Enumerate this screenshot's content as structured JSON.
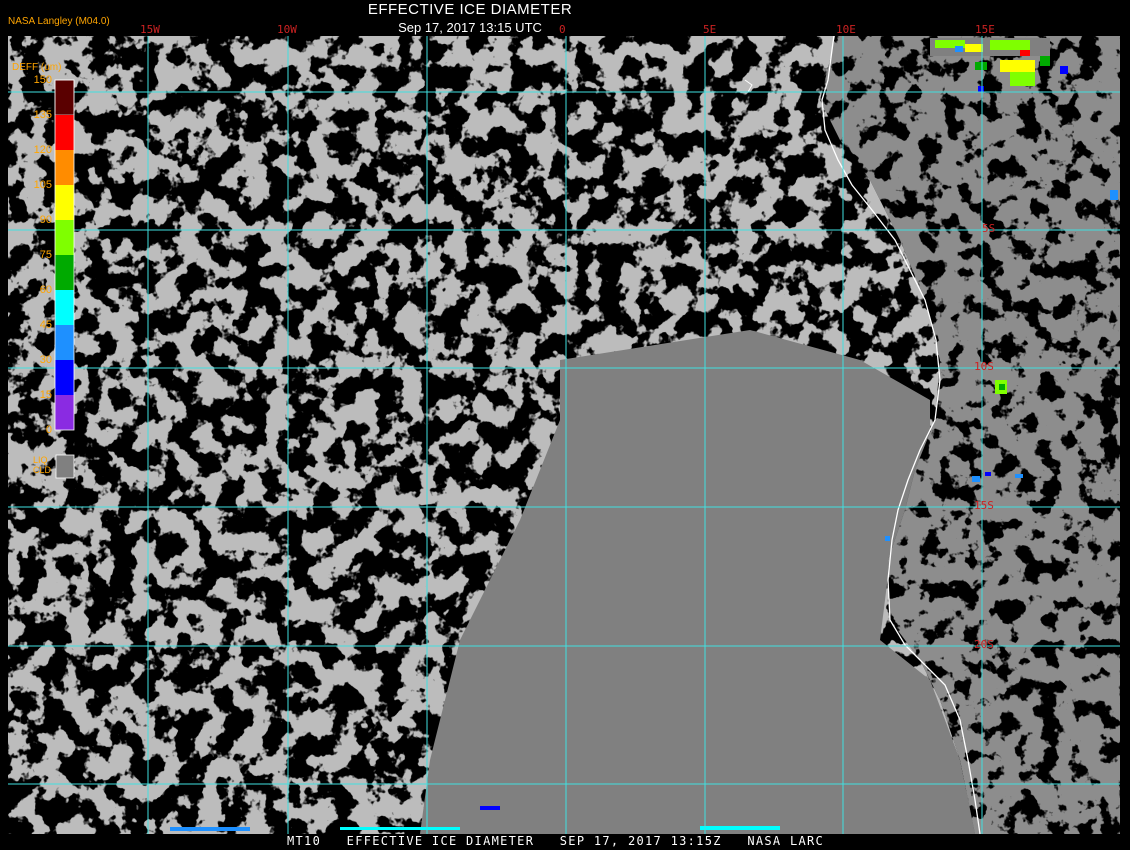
{
  "title": "EFFECTIVE ICE DIAMETER",
  "subtitle": "Sep 17, 2017 13:15 UTC",
  "producer": "NASA Langley (M04.0)",
  "footer": "MT10   EFFECTIVE ICE DIAMETER   SEP 17, 2017 13:15Z   NASA LARC",
  "legend": {
    "title": "DEFF (um)",
    "ticks": [
      "150",
      "135",
      "120",
      "105",
      "90",
      "75",
      "60",
      "45",
      "30",
      "15",
      "0"
    ],
    "colors": [
      "#5a0000",
      "#8b0000",
      "#ff0000",
      "#ff8c00",
      "#ffff00",
      "#7fff00",
      "#00aa00",
      "#00ffff",
      "#1e90ff",
      "#0000ff",
      "#8a2be2"
    ],
    "liq_label_1": "LIQ",
    "liq_label_2": "CLD",
    "liq_color": "#808080"
  },
  "grid": {
    "lon_labels": [
      "15W",
      "10W",
      "0",
      "5E",
      "10E",
      "15E"
    ],
    "lat_labels": [
      "5S",
      "10S",
      "15S",
      "20S"
    ],
    "line_color": "#40e0e0",
    "label_color": "#cc2222"
  },
  "colors": {
    "background": "#000000",
    "cloud": "#808080",
    "coast": "#ffffff"
  }
}
